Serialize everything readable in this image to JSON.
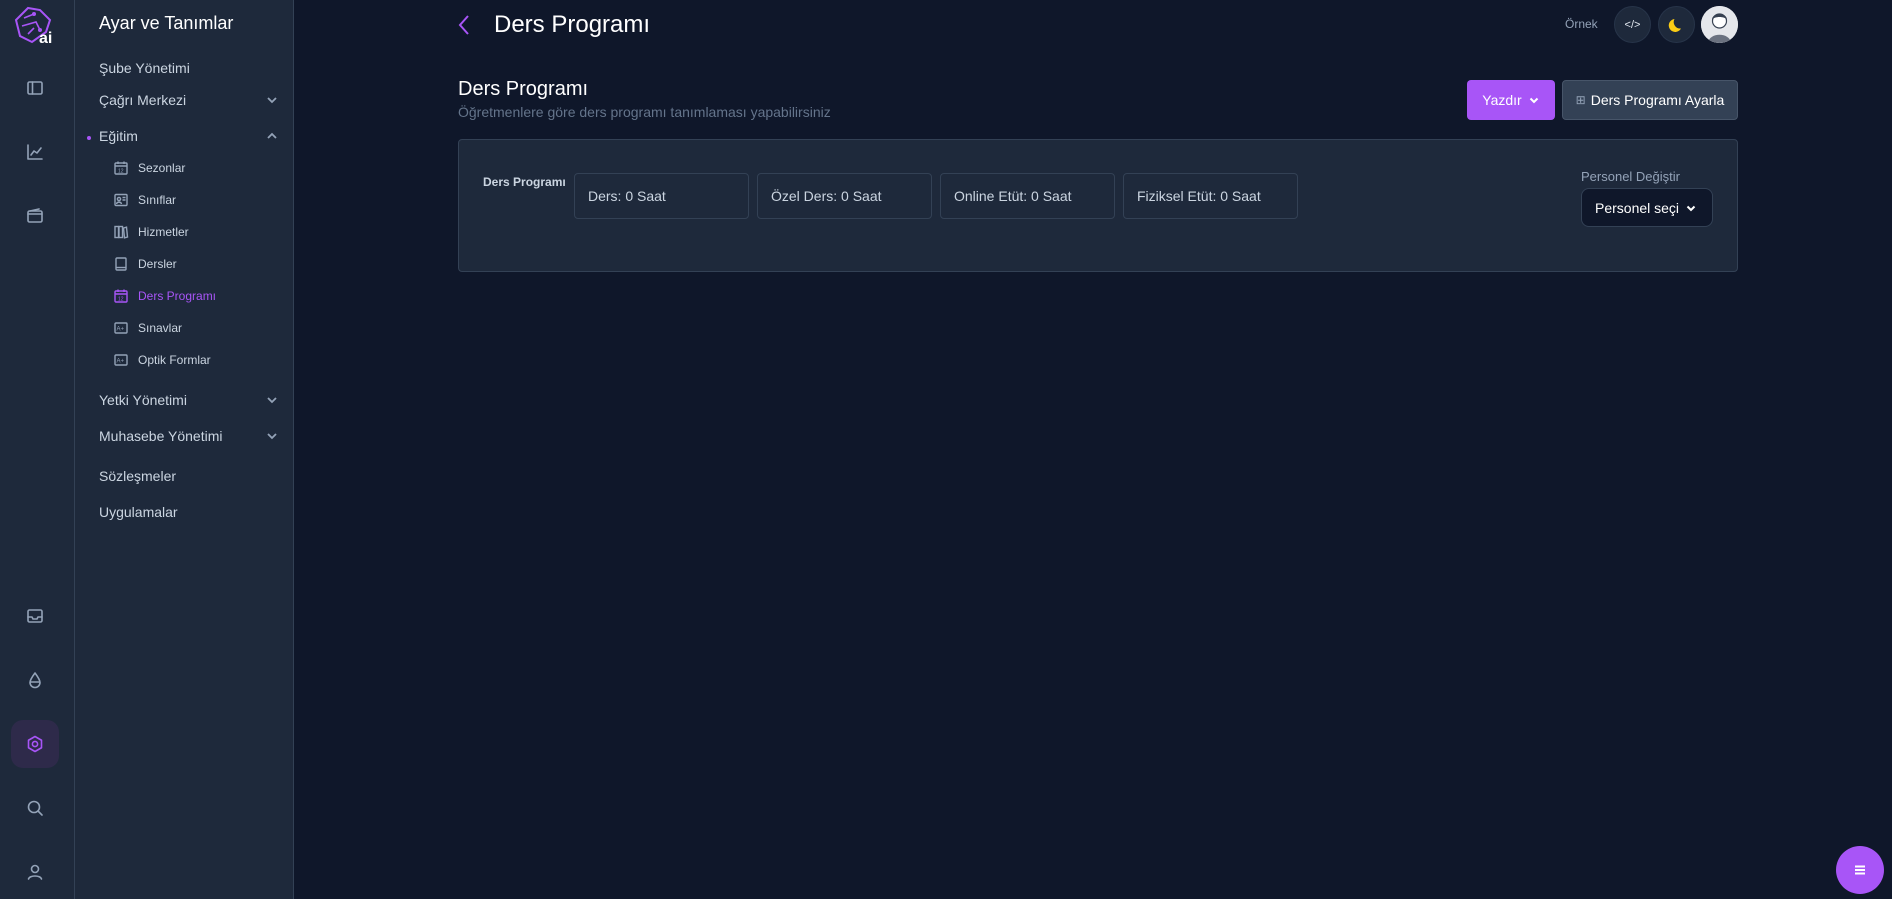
{
  "sidebar": {
    "title": "Ayar ve Tanımlar",
    "items": {
      "sube": "Şube Yönetimi",
      "cagri": "Çağrı Merkezi",
      "egitim": "Eğitim",
      "yetki": "Yetki Yönetimi",
      "muhasebe": "Muhasebe Yönetimi",
      "sozlesmeler": "Sözleşmeler",
      "uygulamalar": "Uygulamalar"
    },
    "egitim_sub": {
      "sezonlar": "Sezonlar",
      "siniflar": "Sınıflar",
      "hizmetler": "Hizmetler",
      "dersler": "Dersler",
      "ders_programi": "Ders Programı",
      "sinavlar": "Sınavlar",
      "optik": "Optik Formlar"
    }
  },
  "header": {
    "title": "Ders Programı",
    "ornek": "Örnek",
    "code_label": "</>"
  },
  "section": {
    "title": "Ders Programı",
    "subtitle": "Öğretmenlere göre ders programı tanımlaması yapabilirsiniz",
    "print_label": "Yazdır",
    "setup_label": "Ders Programı Ayarla"
  },
  "card": {
    "label": "Ders Programı",
    "stats": {
      "ders": "Ders: 0 Saat",
      "ozel": "Özel Ders: 0 Saat",
      "online": "Online Etüt: 0 Saat",
      "fiziksel": "Fiziksel Etüt: 0 Saat"
    },
    "personel_label": "Personel Değiştir",
    "personel_select": "Personel seçi"
  },
  "colors": {
    "accent": "#a855f7",
    "bg": "#0f172a",
    "panel": "#1e293b"
  },
  "icons": [
    "logo-icon",
    "sidebar-toggle-icon",
    "chart-icon",
    "wallet-icon",
    "inbox-icon",
    "drop-icon",
    "settings-icon",
    "search-icon",
    "user-icon",
    "moon-icon",
    "menu-icon"
  ]
}
